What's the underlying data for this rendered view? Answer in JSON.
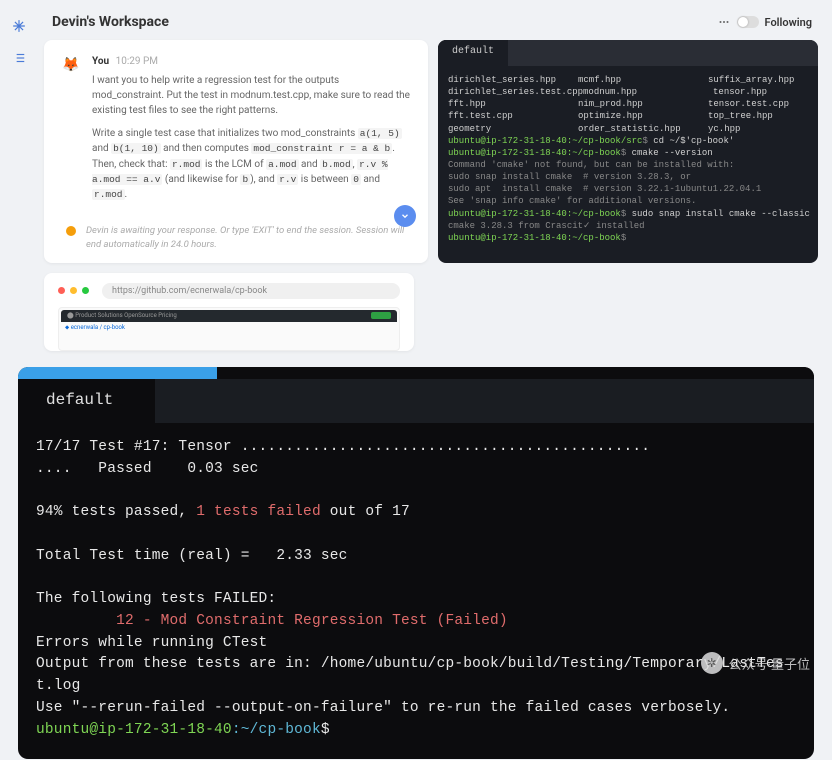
{
  "header": {
    "title": "Devin's Workspace",
    "follow_label": "Following"
  },
  "chat": {
    "author": "You",
    "time": "10:29 PM",
    "p1": "I want you to help write a regression test for the outputs mod_constraint.  Put the test in modnum.test.cpp, make sure to read the existing test files to see the right patterns.",
    "p2_a": "Write a single test case that initializes two mod_constraints ",
    "p2_c1": "a(1, 5)",
    "p2_b": " and ",
    "p2_c2": "b(1, 10)",
    "p2_c": " and then computes ",
    "p2_c3": "mod_constraint r = a & b",
    "p2_d": ". Then, check that: ",
    "p2_c4": "r.mod",
    "p2_e": " is the LCM of ",
    "p2_c5": "a.mod",
    "p2_f": " and ",
    "p2_c6": "b.mod",
    "p2_g": ", ",
    "p2_c7": "r.v % a.mod == a.v",
    "p2_h": " (and likewise for ",
    "p2_c8": "b",
    "p2_i": "), and ",
    "p2_c9": "r.v",
    "p2_j": " is between ",
    "p2_c10": "0",
    "p2_k": " and ",
    "p2_c11": "r.mod",
    "p2_l": ".",
    "status": "Devin is awaiting your response. Or type 'EXIT' to end the session. Session will end automatically in 24.0 hours."
  },
  "small_terminal": {
    "tab": "default",
    "files": [
      [
        "dirichlet_series.hpp",
        "mcmf.hpp",
        "suffix_array.hpp"
      ],
      [
        "dirichlet_series.test.cpp",
        "modnum.hpp",
        "tensor.hpp"
      ],
      [
        "fft.hpp",
        "nim_prod.hpp",
        "tensor.test.cpp"
      ],
      [
        "fft.test.cpp",
        "optimize.hpp",
        "top_tree.hpp"
      ],
      [
        "geometry",
        "order_statistic.hpp",
        "yc.hpp"
      ]
    ],
    "lines": [
      {
        "prompt": "ubuntu@ip-172-31-18-40:~/cp-book/src",
        "sep": "$",
        "cmd": " cd ~/$'cp-book'"
      },
      {
        "prompt": "ubuntu@ip-172-31-18-40:~/cp-book",
        "sep": "$",
        "cmd": " cmake --version"
      },
      {
        "text": "Command 'cmake' not found, but can be installed with:"
      },
      {
        "text": "sudo snap install cmake  # version 3.28.3, or"
      },
      {
        "text": "sudo apt  install cmake  # version 3.22.1-1ubuntu1.22.04.1"
      },
      {
        "text": "See 'snap info cmake' for additional versions."
      },
      {
        "prompt": "ubuntu@ip-172-31-18-40:~/cp-book",
        "sep": "$",
        "cmd": " sudo snap install cmake --classic"
      },
      {
        "text": "cmake 3.28.3 from Crascit✓ installed"
      },
      {
        "prompt": "ubuntu@ip-172-31-18-40:~/cp-book",
        "sep": "$",
        "cmd": ""
      }
    ]
  },
  "browser": {
    "url": "https://github.com/ecnerwala/cp-book"
  },
  "big_terminal": {
    "tab": "default",
    "l1": "17/17 Test #17: Tensor ..............................................",
    "l1b": "....   Passed    0.03 sec",
    "l2a": "94% tests passed, ",
    "l2b": "1 tests failed",
    "l2c": " out of 17",
    "l3": "Total Test time (real) =   2.33 sec",
    "l4": "The following tests FAILED:",
    "l5": "         12 - Mod Constraint Regression Test (Failed)",
    "l6": "Errors while running CTest",
    "l7": "Output from these tests are in: /home/ubuntu/cp-book/build/Testing/Temporary/LastTest.log",
    "l8": "Use \"--rerun-failed --output-on-failure\" to re-run the failed cases verbosely.",
    "prompt_user": "ubuntu@ip-172-31-18-40",
    "prompt_path": ":~/cp-book",
    "prompt_sep": "$"
  },
  "watermark": {
    "text": "公众号·量子位"
  }
}
